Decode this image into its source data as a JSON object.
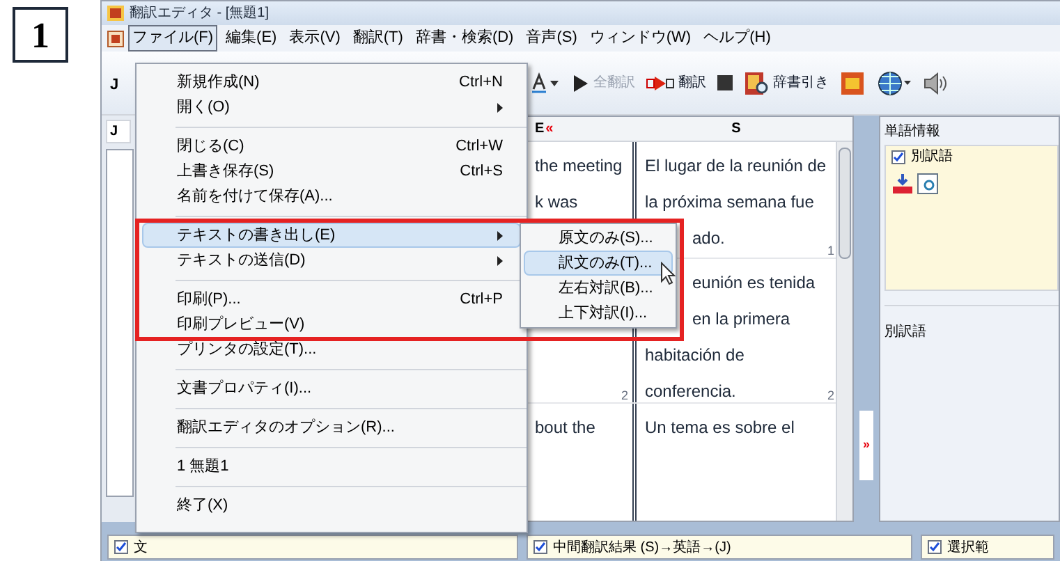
{
  "step_number": "1",
  "window": {
    "title": "翻訳エディタ - [無題1]"
  },
  "menu_bar": [
    {
      "label": "ファイル(F)",
      "selected": true
    },
    {
      "label": "編集(E)",
      "selected": false
    },
    {
      "label": "表示(V)",
      "selected": false
    },
    {
      "label": "翻訳(T)",
      "selected": false
    },
    {
      "label": "辞書・検索(D)",
      "selected": false
    },
    {
      "label": "音声(S)",
      "selected": false
    },
    {
      "label": "ウィンドウ(W)",
      "selected": false
    },
    {
      "label": "ヘルプ(H)",
      "selected": false
    }
  ],
  "toolbar": {
    "left_label": "J",
    "items": [
      {
        "kind": "font"
      },
      {
        "kind": "play",
        "label": "全翻訳",
        "disabled": true
      },
      {
        "kind": "translate",
        "label": "翻訳",
        "disabled": false
      },
      {
        "kind": "stop"
      },
      {
        "kind": "dictionary",
        "label": "辞書引き",
        "disabled": false
      },
      {
        "kind": "ex"
      },
      {
        "kind": "globe"
      },
      {
        "kind": "speaker"
      }
    ]
  },
  "left_pane": {
    "tab": "J"
  },
  "editor": {
    "columns": [
      {
        "header": "E",
        "mark": "«"
      },
      {
        "header": "S"
      }
    ],
    "rows": [
      {
        "source": [
          "the meeting",
          "k was"
        ],
        "target": [
          "El lugar de la reunión de",
          "la próxima semana fue",
          "ado."
        ],
        "number": "1"
      },
      {
        "source": [],
        "target": [
          "eunión es tenida",
          "en la primera",
          "habitación de",
          "conferencia."
        ],
        "number": "2",
        "source_number": "2"
      },
      {
        "source": [
          "bout the"
        ],
        "target": [
          "Un tema es sobre el"
        ]
      }
    ]
  },
  "word_panel": {
    "title": "単語情報",
    "checkbox": {
      "label": "別訳語",
      "checked": true
    },
    "list_label": "別訳語",
    "expand_mark": "»"
  },
  "bottom": [
    {
      "label": "文",
      "checked": true
    },
    {
      "label": "中間翻訳結果 (S)→英語→(J)",
      "checked": true
    },
    {
      "label": "選択範",
      "checked": true
    }
  ],
  "file_menu": [
    {
      "kind": "item",
      "label": "新規作成(N)",
      "shortcut": "Ctrl+N",
      "submenu": false,
      "selected": false
    },
    {
      "kind": "item",
      "label": "開く(O)",
      "submenu": true,
      "selected": false
    },
    {
      "kind": "separator"
    },
    {
      "kind": "item",
      "label": "閉じる(C)",
      "shortcut": "Ctrl+W",
      "submenu": false,
      "selected": false
    },
    {
      "kind": "item",
      "label": "上書き保存(S)",
      "shortcut": "Ctrl+S",
      "submenu": false,
      "selected": false
    },
    {
      "kind": "item",
      "label": "名前を付けて保存(A)...",
      "submenu": false,
      "selected": false
    },
    {
      "kind": "separator"
    },
    {
      "kind": "item",
      "label": "テキストの書き出し(E)",
      "submenu": true,
      "selected": true
    },
    {
      "kind": "item",
      "label": "テキストの送信(D)",
      "submenu": true,
      "selected": false
    },
    {
      "kind": "separator"
    },
    {
      "kind": "item",
      "label": "印刷(P)...",
      "shortcut": "Ctrl+P",
      "submenu": false,
      "selected": false
    },
    {
      "kind": "item",
      "label": "印刷プレビュー(V)",
      "submenu": false,
      "selected": false
    },
    {
      "kind": "item",
      "label": "プリンタの設定(T)...",
      "submenu": false,
      "selected": false
    },
    {
      "kind": "separator"
    },
    {
      "kind": "item",
      "label": "文書プロパティ(I)...",
      "submenu": false,
      "selected": false
    },
    {
      "kind": "separator"
    },
    {
      "kind": "item",
      "label": "翻訳エディタのオプション(R)...",
      "submenu": false,
      "selected": false
    },
    {
      "kind": "separator"
    },
    {
      "kind": "item",
      "label": "1 無題1",
      "submenu": false,
      "selected": false
    },
    {
      "kind": "separator"
    },
    {
      "kind": "item",
      "label": "終了(X)",
      "submenu": false,
      "selected": false
    }
  ],
  "export_submenu": [
    {
      "label": "原文のみ(S)...",
      "selected": false
    },
    {
      "label": "訳文のみ(T)...",
      "selected": true
    },
    {
      "label": "左右対訳(B)...",
      "selected": false
    },
    {
      "label": "上下対訳(I)...",
      "selected": false
    }
  ]
}
